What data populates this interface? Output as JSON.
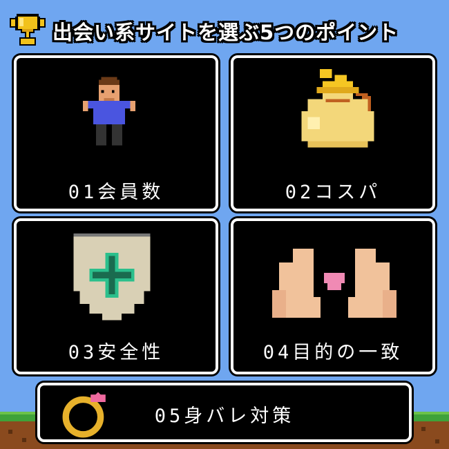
{
  "header": {
    "title": "出会い系サイトを選ぶ5つのポイント",
    "icon": "trophy-icon"
  },
  "cards": [
    {
      "label": "01会員数",
      "icon": "person-icon"
    },
    {
      "label": "02コスパ",
      "icon": "money-bag-icon"
    },
    {
      "label": "03安全性",
      "icon": "shield-icon"
    },
    {
      "label": "04目的の一致",
      "icon": "heart-hands-icon"
    },
    {
      "label": "05身バレ対策",
      "icon": "ring-icon"
    }
  ],
  "colors": {
    "sky": "#6fa6f0",
    "card_bg": "#000000",
    "card_border": "#ffffff",
    "grass": "#3fa23a",
    "dirt": "#8a4a1e"
  }
}
